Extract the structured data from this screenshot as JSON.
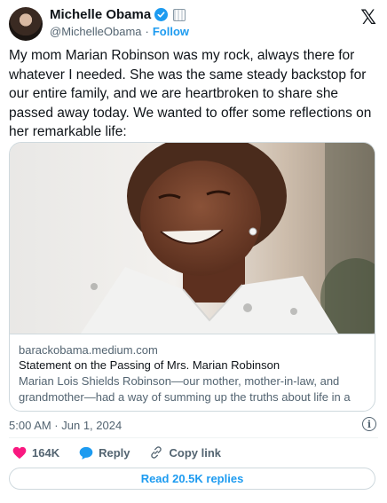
{
  "author": {
    "name": "Michelle Obama",
    "handle": "@MichelleObama",
    "separator": "·",
    "follow_label": "Follow",
    "verified_icon": "verified-badge-icon",
    "affiliation_icon": "government-badge-icon"
  },
  "tweet": {
    "text": "My mom Marian Robinson was my rock, always there for whatever I needed. She was the same steady backstop for our entire family, and we are heartbroken to share she passed away today. We wanted to offer some reflections on her remarkable life:"
  },
  "card": {
    "domain": "barackobama.medium.com",
    "title": "Statement on the Passing of Mrs. Marian Robinson",
    "description": "Marian Lois Shields Robinson—our mother, mother-in-law, and grandmother—had a way of summing up the truths about life in a wor..."
  },
  "meta": {
    "timestamp": "5:00 AM · Jun 1, 2024"
  },
  "actions": {
    "likes": "164K",
    "reply_label": "Reply",
    "copy_link_label": "Copy link"
  },
  "replies_button": "Read 20.5K replies",
  "colors": {
    "accent": "#1d9bf0",
    "like": "#f91880",
    "text": "#0f1419",
    "secondary": "#536471"
  }
}
